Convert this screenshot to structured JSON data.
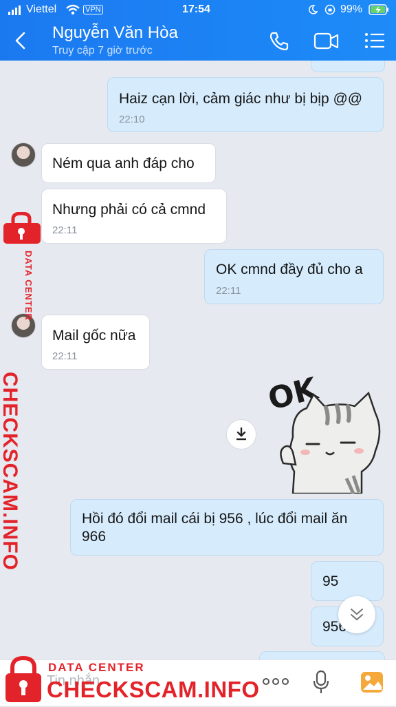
{
  "status": {
    "carrier": "Viettel",
    "vpn": "VPN",
    "time": "17:54",
    "battery": "99%"
  },
  "header": {
    "contact_name": "Nguyễn Văn Hòa",
    "last_seen": "Truy cập 7 giờ trước"
  },
  "messages": [
    {
      "dir": "out",
      "text": "Haiz cạn lời, cảm giác như bị bịp @@",
      "time": "22:10"
    },
    {
      "dir": "in",
      "text": "Ném qua anh đáp cho",
      "time": ""
    },
    {
      "dir": "in",
      "text": "Nhưng phải có cả cmnd",
      "time": "22:11"
    },
    {
      "dir": "out",
      "text": "OK cmnd đầy đủ cho a",
      "time": "22:11"
    },
    {
      "dir": "in",
      "text": "Mail gốc nữa",
      "time": "22:11"
    },
    {
      "dir": "out",
      "type": "sticker",
      "sticker_text": "OK"
    },
    {
      "dir": "out",
      "text_line1": "Hồi đó đổi mail cái bị 956 , lúc đổi mail ăn",
      "text_line2": "966"
    },
    {
      "dir": "out",
      "text": "95"
    },
    {
      "dir": "out",
      "text": "956"
    }
  ],
  "composer": {
    "placeholder": "Tin nhắn"
  },
  "watermark": {
    "small": "DATA CENTER",
    "big": "CHECKSCAM.INFO"
  },
  "colors": {
    "header_bg": "#1d84f5",
    "out_bubble": "#d6ecfd",
    "in_bubble": "#ffffff",
    "chat_bg": "#e6eaf0",
    "watermark": "#e3232a"
  }
}
